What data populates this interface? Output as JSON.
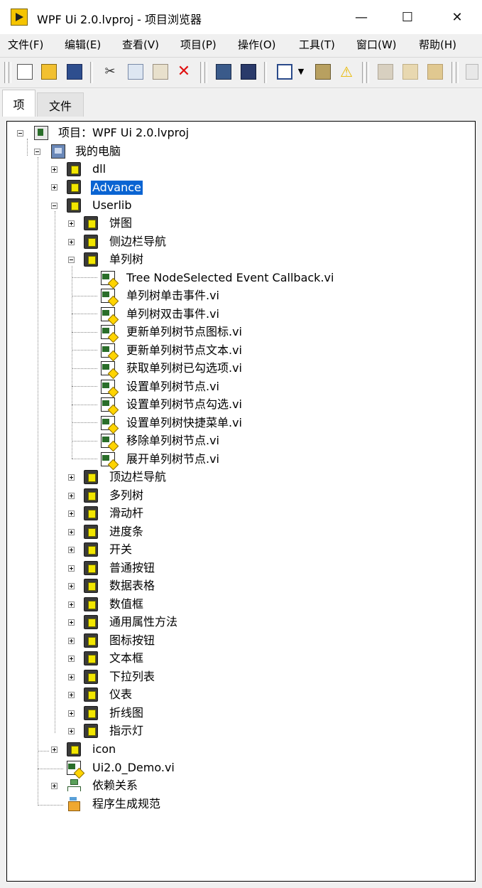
{
  "window": {
    "title": "WPF Ui 2.0.lvproj - 项目浏览器",
    "minimize_glyph": "—",
    "maximize_glyph": "☐",
    "close_glyph": "✕"
  },
  "menu": [
    "文件(F)",
    "编辑(E)",
    "查看(V)",
    "项目(P)",
    "操作(O)",
    "工具(T)",
    "窗口(W)",
    "帮助(H)"
  ],
  "tabs": [
    "项",
    "文件"
  ],
  "colors": {
    "selection": "#0a64d2",
    "folder_yellow": "#f2e600",
    "delete_red": "#e01010"
  },
  "toolbar_icons": [
    "new-icon",
    "open-icon",
    "save-all-icon",
    "cut-icon",
    "copy-icon",
    "paste-icon",
    "delete-icon",
    "project-properties-icon",
    "save-icon",
    "view-dropdown-icon",
    "filter-icon",
    "warning-icon",
    "hierarchy-icon",
    "package-icon",
    "export-icon",
    "run-icon"
  ],
  "tree": {
    "project": "项目：WPF Ui 2.0.lvproj",
    "computer": "我的电脑",
    "dll": "dll",
    "advance": "Advance",
    "userlib": "Userlib",
    "userlib_children": {
      "pie_chart": "饼图",
      "side_nav": "侧边栏导航",
      "single_tree": "单列树",
      "single_tree_vis": [
        "Tree NodeSelected Event Callback.vi",
        "单列树单击事件.vi",
        "单列树双击事件.vi",
        "更新单列树节点图标.vi",
        "更新单列树节点文本.vi",
        "获取单列树已勾选项.vi",
        "设置单列树节点.vi",
        "设置单列树节点勾选.vi",
        "设置单列树快捷菜单.vi",
        "移除单列树节点.vi",
        "展开单列树节点.vi"
      ],
      "more": [
        "顶边栏导航",
        "多列树",
        "滑动杆",
        "进度条",
        "开关",
        "普通按钮",
        "数据表格",
        "数值框",
        "通用属性方法",
        "图标按钮",
        "文本框",
        "下拉列表",
        "仪表",
        "折线图",
        "指示灯"
      ]
    },
    "icon": "icon",
    "demo_vi": "Ui2.0_Demo.vi",
    "dependencies": "依赖关系",
    "build_specs": "程序生成规范"
  }
}
